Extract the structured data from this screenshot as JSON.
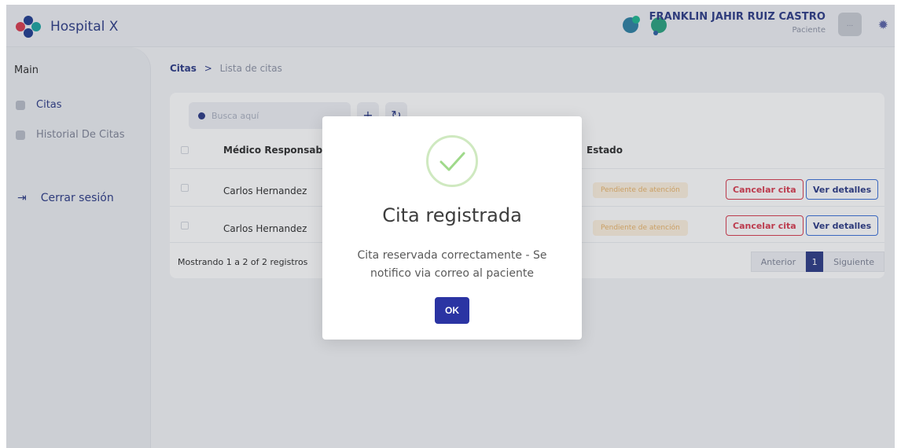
{
  "header": {
    "brand": "Hospital X",
    "user_name": "FRANKLIN JAHIR RUIZ CASTRO",
    "user_role": "Paciente",
    "avatar_text": "..."
  },
  "sidebar": {
    "section": "Main",
    "items": [
      {
        "label": "Citas"
      },
      {
        "label": "Historial De Citas"
      }
    ],
    "logout": "Cerrar sesión"
  },
  "breadcrumb": {
    "root": "Citas",
    "separator": ">",
    "current": "Lista de citas"
  },
  "table": {
    "search_placeholder": "Busca aquí",
    "add_icon": "+",
    "refresh_icon": "↻",
    "columns": [
      "Médico Responsable",
      "Estado"
    ],
    "rows": [
      {
        "doctor": "Carlos Hernandez",
        "status": "Pendiente de atención",
        "cancel": "Cancelar cita",
        "details": "Ver detalles"
      },
      {
        "doctor": "Carlos Hernandez",
        "status": "Pendiente de atención",
        "cancel": "Cancelar cita",
        "details": "Ver detalles"
      }
    ],
    "footer": "Mostrando 1 a 2 of 2 registros",
    "pagination": {
      "prev": "Anterior",
      "current": "1",
      "next": "Siguiente"
    }
  },
  "modal": {
    "title": "Cita registrada",
    "message": "Cita reservada correctamente - Se notifico via correo al paciente",
    "ok": "OK",
    "icon": "success-check-icon"
  },
  "colors": {
    "brand": "#2b3a86",
    "danger": "#d83a4e",
    "success": "#8fd07a",
    "primary_button": "#2b34a3",
    "warning_badge": "#fdf1de"
  }
}
